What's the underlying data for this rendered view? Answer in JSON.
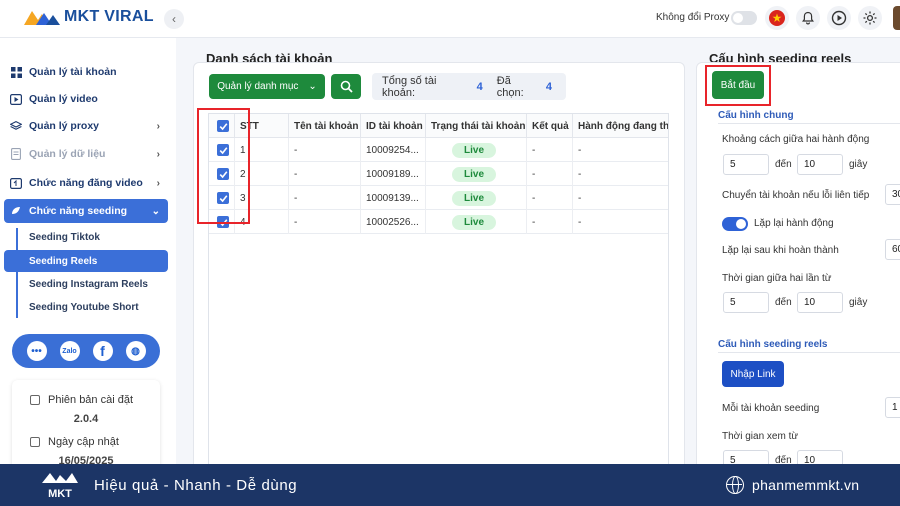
{
  "app": {
    "name": "MKT VIRAL"
  },
  "topbar": {
    "proxy_label": "Không đổi Proxy"
  },
  "sidebar": {
    "items": [
      {
        "label": "Quản lý tài khoản"
      },
      {
        "label": "Quản lý video"
      },
      {
        "label": "Quản lý proxy"
      },
      {
        "label": "Quản lý dữ liệu"
      },
      {
        "label": "Chức năng đăng video"
      },
      {
        "label": "Chức năng seeding"
      }
    ],
    "subitems": [
      {
        "label": "Seeding Tiktok"
      },
      {
        "label": "Seeding Reels"
      },
      {
        "label": "Seeding Instagram Reels"
      },
      {
        "label": "Seeding Youtube Short"
      }
    ],
    "version_label": "Phiên bản cài đặt",
    "version": "2.0.4",
    "updated_label": "Ngày cập nhật",
    "updated": "16/05/2025"
  },
  "main": {
    "title": "Danh sách tài khoản",
    "category_button": "Quản lý danh mục",
    "total_label": "Tổng số tài khoản:",
    "total": "4",
    "selected_label": "Đã chọn:",
    "selected": "4",
    "columns": [
      "STT",
      "Tên tài khoản",
      "ID tài khoản",
      "Trạng thái tài khoản",
      "Kết quả",
      "Hành động đang thực"
    ],
    "rows": [
      {
        "stt": "1",
        "name": "-",
        "id": "10009254...",
        "status": "Live",
        "result": "-",
        "action": "-"
      },
      {
        "stt": "2",
        "name": "-",
        "id": "10009189...",
        "status": "Live",
        "result": "-",
        "action": "-"
      },
      {
        "stt": "3",
        "name": "-",
        "id": "10009139...",
        "status": "Live",
        "result": "-",
        "action": "-"
      },
      {
        "stt": "4",
        "name": "-",
        "id": "10002526...",
        "status": "Live",
        "result": "-",
        "action": "-"
      }
    ]
  },
  "config": {
    "title": "Cấu hình seeding reels",
    "start_button": "Bắt đầu",
    "general_title": "Cấu hình chung",
    "delay_label": "Khoảng cách giữa hai hành động",
    "delay_from": "5",
    "delay_to": "10",
    "to_word": "đến",
    "seconds": "giây",
    "switch_label": "Chuyển tài khoản nếu lỗi liên tiếp",
    "switch_value": "30",
    "repeat_label": "Lặp lại hành động",
    "repeat_after_label": "Lặp lại sau khi hoàn thành",
    "repeat_after_value": "60",
    "between_label": "Thời gian giữa hai lần từ",
    "between_from": "5",
    "between_to": "10",
    "reels_title": "Cấu hình seeding reels",
    "import_button": "Nhập Link",
    "per_account_label": "Mỗi tài khoản seeding",
    "per_account_value": "1",
    "watch_label": "Thời gian xem từ",
    "watch_from": "5",
    "watch_to": "10"
  },
  "footer": {
    "slogan": "Hiệu quả - Nhanh - Dễ dùng",
    "website": "phanmemmkt.vn"
  },
  "colors": {
    "accent": "#3b6fd8",
    "green": "#1e8a3c",
    "footer": "#1c3566",
    "highlight": "#e8242a"
  }
}
